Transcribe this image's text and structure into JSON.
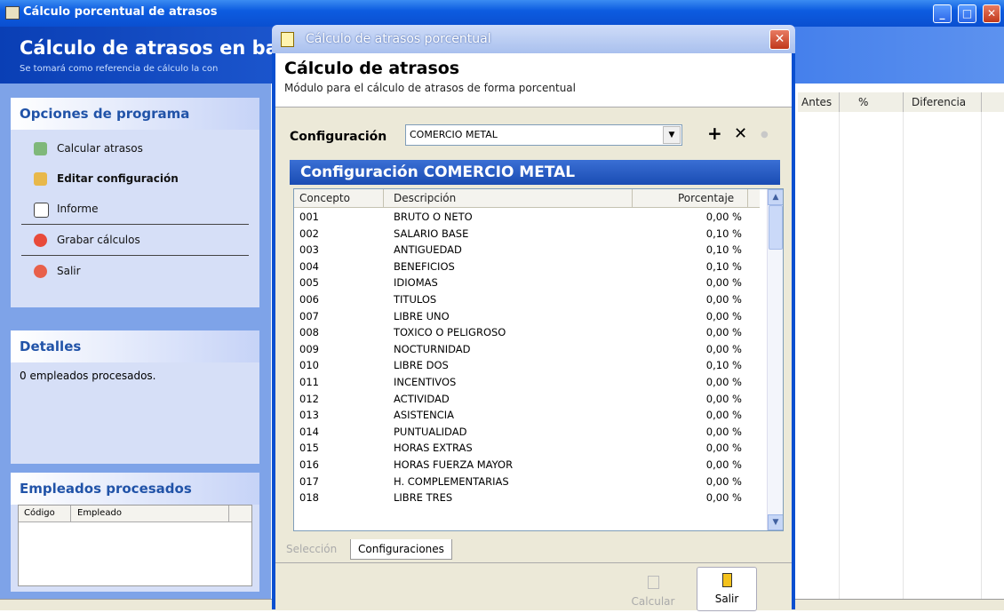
{
  "bg_window": {
    "title": "Cálculo porcentual de atrasos",
    "header_title": "Cálculo de atrasos en base",
    "header_subtitle": "Se tomará como referencia de cálculo la con"
  },
  "options_panel": {
    "title": "Opciones de programa",
    "items": [
      "Calcular atrasos",
      "Editar configuración",
      "Informe",
      "Grabar cálculos",
      "Salir"
    ]
  },
  "details_panel": {
    "title": "Detalles",
    "text": "0 empleados procesados."
  },
  "employees_panel": {
    "title": "Empleados procesados",
    "col_code": "Código",
    "col_employee": "Empleado"
  },
  "grid_headers": [
    "Antes",
    "%",
    "Diferencia"
  ],
  "dialog": {
    "title": "Cálculo de atrasos porcentual",
    "heading": "Cálculo de atrasos",
    "subheading": "Módulo para el cálculo de atrasos de forma porcentual",
    "config_label": "Configuración",
    "config_value": "COMERCIO METAL",
    "banner": "Configuración COMERCIO METAL",
    "col_concepto": "Concepto",
    "col_descripcion": "Descripción",
    "col_porcentaje": "Porcentaje",
    "rows": [
      [
        "001",
        "BRUTO O NETO",
        "0,00 %"
      ],
      [
        "002",
        "SALARIO BASE",
        "0,10 %"
      ],
      [
        "003",
        "ANTIGUEDAD",
        "0,10 %"
      ],
      [
        "004",
        "BENEFICIOS",
        "0,10 %"
      ],
      [
        "005",
        "IDIOMAS",
        "0,00 %"
      ],
      [
        "006",
        "TITULOS",
        "0,00 %"
      ],
      [
        "007",
        "LIBRE UNO",
        "0,00 %"
      ],
      [
        "008",
        "TOXICO O PELIGROSO",
        "0,00 %"
      ],
      [
        "009",
        "NOCTURNIDAD",
        "0,00 %"
      ],
      [
        "010",
        "LIBRE DOS",
        "0,10 %"
      ],
      [
        "011",
        "INCENTIVOS",
        "0,00 %"
      ],
      [
        "012",
        "ACTIVIDAD",
        "0,00 %"
      ],
      [
        "013",
        "ASISTENCIA",
        "0,00 %"
      ],
      [
        "014",
        "PUNTUALIDAD",
        "0,00 %"
      ],
      [
        "015",
        "HORAS EXTRAS",
        "0,00 %"
      ],
      [
        "016",
        "HORAS FUERZA MAYOR",
        "0,00 %"
      ],
      [
        "017",
        "H. COMPLEMENTARIAS",
        "0,00 %"
      ],
      [
        "018",
        "LIBRE TRES",
        "0,00 %"
      ]
    ],
    "tab_seleccion": "Selección",
    "tab_configuraciones": "Configuraciones",
    "btn_calcular": "Calcular",
    "btn_salir": "Salir",
    "add_glyph": "+",
    "delete_glyph": "✕",
    "dot_glyph": "●",
    "close_glyph": "✕"
  }
}
